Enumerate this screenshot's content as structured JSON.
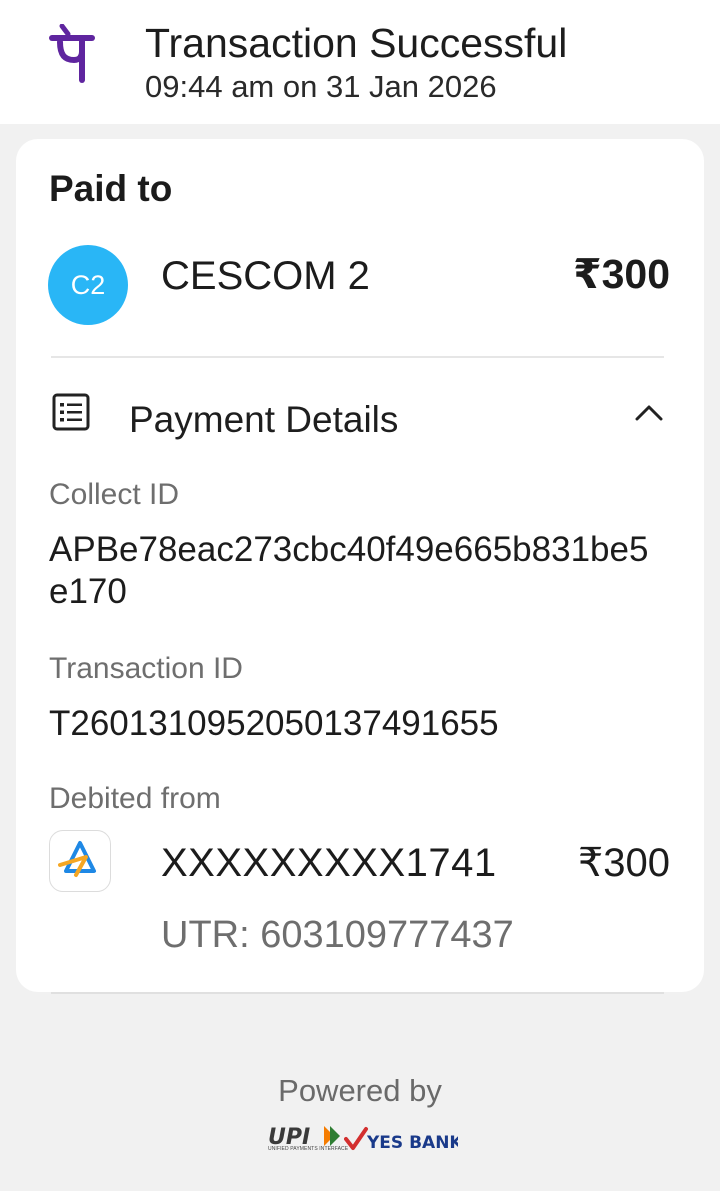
{
  "header": {
    "title": "Transaction Successful",
    "subtitle": "09:44 am on 31 Jan 2026",
    "logo_icon": "phonepe-logo",
    "brand_color": "#5f259f"
  },
  "card": {
    "paid_to_label": "Paid to",
    "payee": {
      "avatar_initials": "C2",
      "avatar_color": "#29b6f6",
      "name": "CESCOM 2",
      "amount": "₹300"
    },
    "payment_details": {
      "title": "Payment Details",
      "icon": "list-details-icon",
      "toggle_icon": "chevron-up-icon",
      "collect_id_label": "Collect ID",
      "collect_id": "APBe78eac273cbc40f49e665b831be5e170",
      "transaction_id_label": "Transaction ID",
      "transaction_id": "T2601310952050137491655",
      "debited_from_label": "Debited from",
      "account": "XXXXXXXXX1741",
      "debit_amount": "₹300",
      "utr": "UTR: 603109777437",
      "bank_icon": "bank-icon"
    }
  },
  "footer": {
    "powered_by": "Powered by",
    "upi_logo_text": "UPI",
    "upi_subtext": "UNIFIED PAYMENTS INTERFACE",
    "bank_logo_text": "YES BANK"
  }
}
